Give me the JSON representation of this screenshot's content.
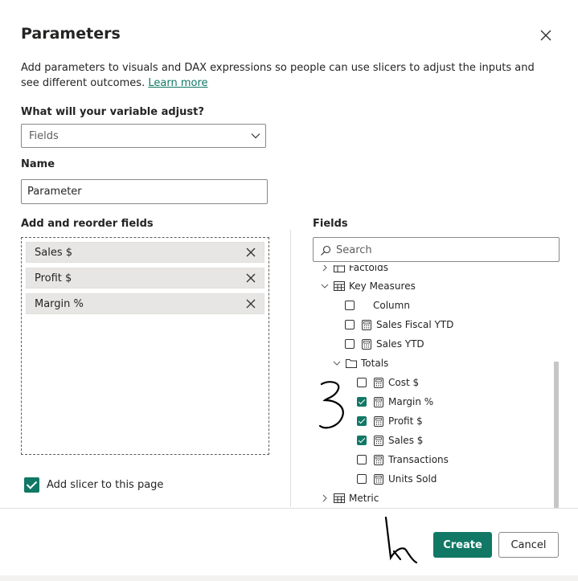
{
  "dialog": {
    "title": "Parameters",
    "description": "Add parameters to visuals and DAX expressions so people can use slicers to adjust the inputs and see different outcomes.",
    "learn_more": "Learn more"
  },
  "variable": {
    "label": "What will your variable adjust?",
    "selected": "Fields"
  },
  "name": {
    "label": "Name",
    "value": "Parameter"
  },
  "fields_list": {
    "label": "Add and reorder fields",
    "items": [
      "Sales $",
      "Profit $",
      "Margin %"
    ]
  },
  "fields_tree": {
    "label": "Fields",
    "search_placeholder": "Search",
    "partial_top": "Factoids",
    "key_measures": "Key Measures",
    "key_items": [
      {
        "label": "Column",
        "checked": false,
        "icon": "none"
      },
      {
        "label": "Sales Fiscal YTD",
        "checked": false,
        "icon": "calculator-icon"
      },
      {
        "label": "Sales YTD",
        "checked": false,
        "icon": "calculator-icon"
      }
    ],
    "totals": "Totals",
    "totals_items": [
      {
        "label": "Cost $",
        "checked": false
      },
      {
        "label": "Margin %",
        "checked": true
      },
      {
        "label": "Profit $",
        "checked": true
      },
      {
        "label": "Sales $",
        "checked": true
      },
      {
        "label": "Transactions",
        "checked": false
      },
      {
        "label": "Units Sold",
        "checked": false
      }
    ],
    "metric": "Metric"
  },
  "slicer": {
    "label": "Add slicer to this page",
    "checked": true
  },
  "buttons": {
    "create": "Create",
    "cancel": "Cancel"
  },
  "colors": {
    "accent": "#117865",
    "text": "#252423",
    "border": "#8a8886"
  }
}
